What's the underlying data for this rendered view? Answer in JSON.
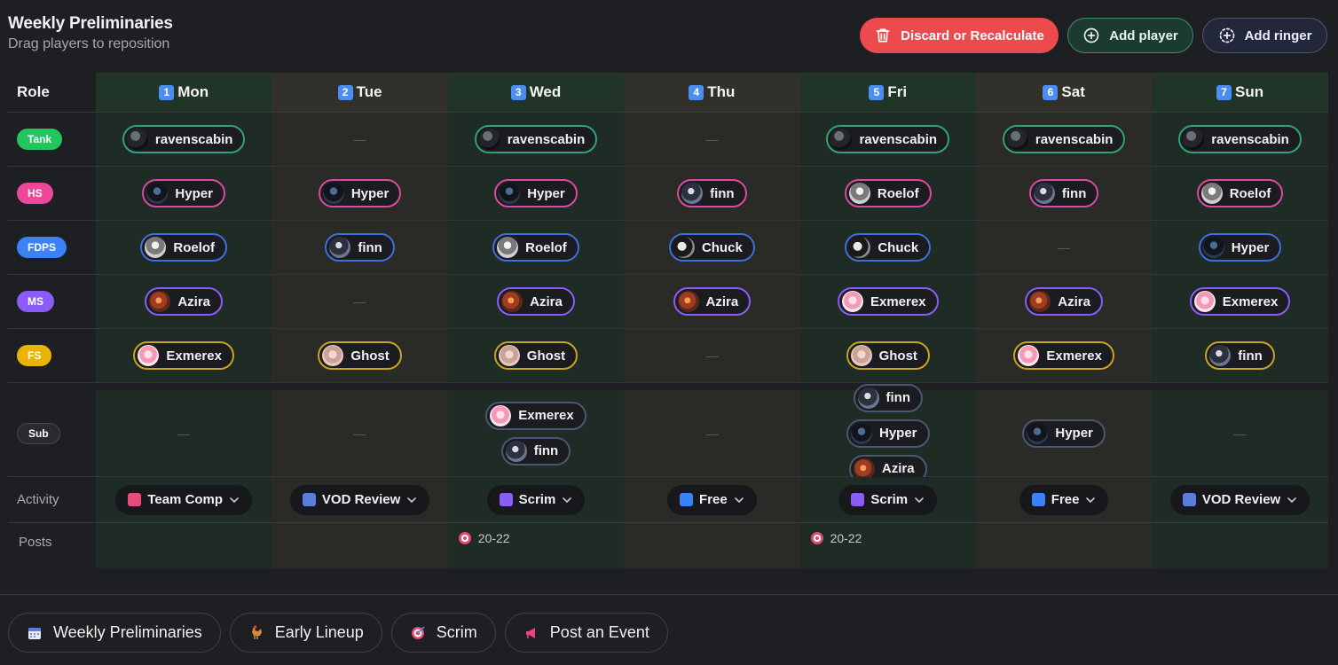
{
  "header": {
    "title": "Weekly Preliminaries",
    "subtitle": "Drag players to reposition"
  },
  "actions": {
    "discard": "Discard or Recalculate",
    "add_player": "Add player",
    "add_ringer": "Add ringer"
  },
  "colors": {
    "tank": "#22c55e",
    "hs": "#ec4899",
    "fdps": "#3b82f6",
    "ms": "#8b5cf6",
    "fs": "#eab308",
    "sub": "#2a2b30"
  },
  "grid": {
    "role_header": "Role",
    "days": [
      {
        "num": "1",
        "label": "Mon"
      },
      {
        "num": "2",
        "label": "Tue"
      },
      {
        "num": "3",
        "label": "Wed"
      },
      {
        "num": "4",
        "label": "Thu"
      },
      {
        "num": "5",
        "label": "Fri"
      },
      {
        "num": "6",
        "label": "Sat"
      },
      {
        "num": "7",
        "label": "Sun"
      }
    ],
    "roles": [
      {
        "label": "Tank",
        "key": "tank",
        "players": [
          "ravenscabin",
          "",
          "ravenscabin",
          "",
          "ravenscabin",
          "ravenscabin",
          "ravenscabin"
        ]
      },
      {
        "label": "HS",
        "key": "hs",
        "players": [
          "Hyper",
          "Hyper",
          "Hyper",
          "finn",
          "Roelof",
          "finn",
          "Roelof"
        ]
      },
      {
        "label": "FDPS",
        "key": "fdps",
        "players": [
          "Roelof",
          "finn",
          "Roelof",
          "Chuck",
          "Chuck",
          "",
          "Hyper"
        ]
      },
      {
        "label": "MS",
        "key": "ms",
        "players": [
          "Azira",
          "",
          "Azira",
          "Azira",
          "Exmerex",
          "Azira",
          "Exmerex"
        ]
      },
      {
        "label": "FS",
        "key": "fs",
        "players": [
          "Exmerex",
          "Ghost",
          "Ghost",
          "",
          "Ghost",
          "Exmerex",
          "finn"
        ]
      }
    ],
    "sub": {
      "label": "Sub",
      "players": [
        [],
        [],
        [
          "Exmerex",
          "finn"
        ],
        [],
        [
          "finn",
          "Hyper",
          "Azira"
        ],
        [
          "Hyper"
        ],
        []
      ]
    },
    "empty_marker": "—",
    "activity": {
      "label": "Activity",
      "values": [
        {
          "label": "Team Comp",
          "icon": "team-comp-icon"
        },
        {
          "label": "VOD Review",
          "icon": "vod-review-icon"
        },
        {
          "label": "Scrim",
          "icon": "scrim-icon"
        },
        {
          "label": "Free",
          "icon": "free-icon"
        },
        {
          "label": "Scrim",
          "icon": "scrim-icon"
        },
        {
          "label": "Free",
          "icon": "free-icon"
        },
        {
          "label": "VOD Review",
          "icon": "vod-review-icon"
        }
      ]
    },
    "posts": {
      "label": "Posts",
      "values": [
        "",
        "",
        "20-22",
        "",
        "20-22",
        "",
        ""
      ]
    }
  },
  "bottom_tabs": [
    {
      "label": "Weekly Preliminaries",
      "icon": "calendar-icon"
    },
    {
      "label": "Early Lineup",
      "icon": "rooster-icon"
    },
    {
      "label": "Scrim",
      "icon": "target-icon"
    },
    {
      "label": "Post an Event",
      "icon": "megaphone-icon"
    }
  ]
}
